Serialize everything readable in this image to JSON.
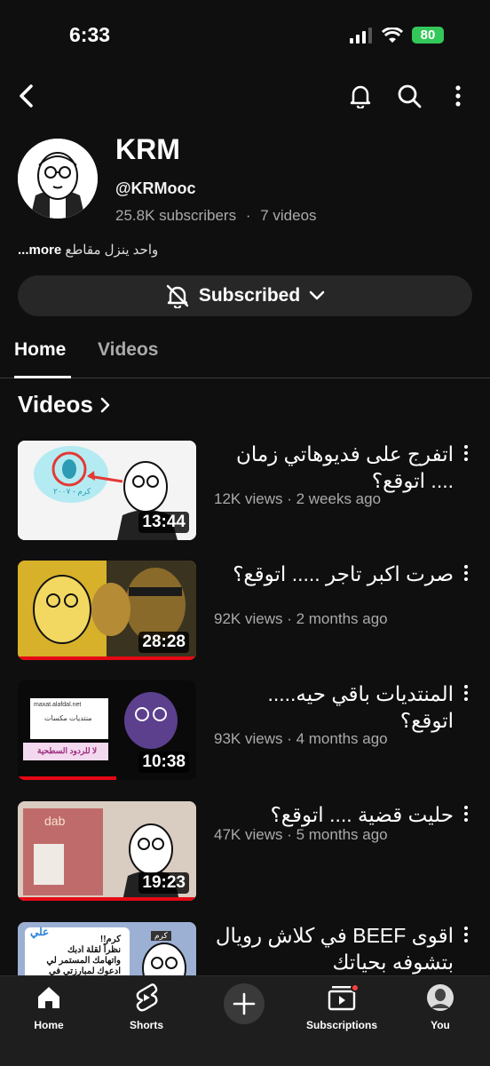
{
  "status": {
    "time": "6:33",
    "battery": "80"
  },
  "channel": {
    "name": "KRM",
    "handle": "@KRMooc",
    "subscribers": "25.8K subscribers",
    "separator": "·",
    "videos_count": "7 videos",
    "description": "واحد ينزل مقاطع",
    "more_label": "...more"
  },
  "subscribe": {
    "label": "Subscribed"
  },
  "tabs": [
    {
      "label": "Home"
    },
    {
      "label": "Videos"
    }
  ],
  "section": {
    "title": "Videos"
  },
  "videos": [
    {
      "title": "اتفرج على فديوهاتي زمان .... اتوقع؟",
      "views": "12K views",
      "age": "2 weeks ago",
      "duration": "13:44"
    },
    {
      "title": "صرت اكبر تاجر ..... اتوقع؟",
      "views": "92K views",
      "age": "2 months ago",
      "duration": "28:28"
    },
    {
      "title": "المنتديات باقي حيه..... اتوقع؟",
      "views": "93K views",
      "age": "4 months ago",
      "duration": "10:38"
    },
    {
      "title": "حليت قضية .... اتوقع؟",
      "views": "47K views",
      "age": "5 months ago",
      "duration": "19:23"
    },
    {
      "title": "اقوى BEEF في كلاش رويال بتشوفه بحياتك",
      "views": "",
      "age": "",
      "duration": ""
    }
  ],
  "thumb_text": {
    "v1_caption": "كرم - ٢٠٠٧",
    "v3_url": "maxat.alafdal.net",
    "v3_forum": "منتديات مكسات",
    "v3_banner": "لا للردود السطحية",
    "v4_brand": "dab",
    "v5_name": "علي",
    "v5_line1": "كرم!!",
    "v5_line2": "نظراً لقلة ادبك",
    "v5_line3": "واتهامك المستمر لي",
    "v5_line4": "ادعوك لمبارزتي في",
    "v5_tag": "كرم"
  },
  "bottom_nav": [
    {
      "label": "Home",
      "icon": "home-icon"
    },
    {
      "label": "Shorts",
      "icon": "shorts-icon"
    },
    {
      "label": "Subscriptions",
      "icon": "subscriptions-icon"
    },
    {
      "label": "You",
      "icon": "avatar"
    }
  ]
}
